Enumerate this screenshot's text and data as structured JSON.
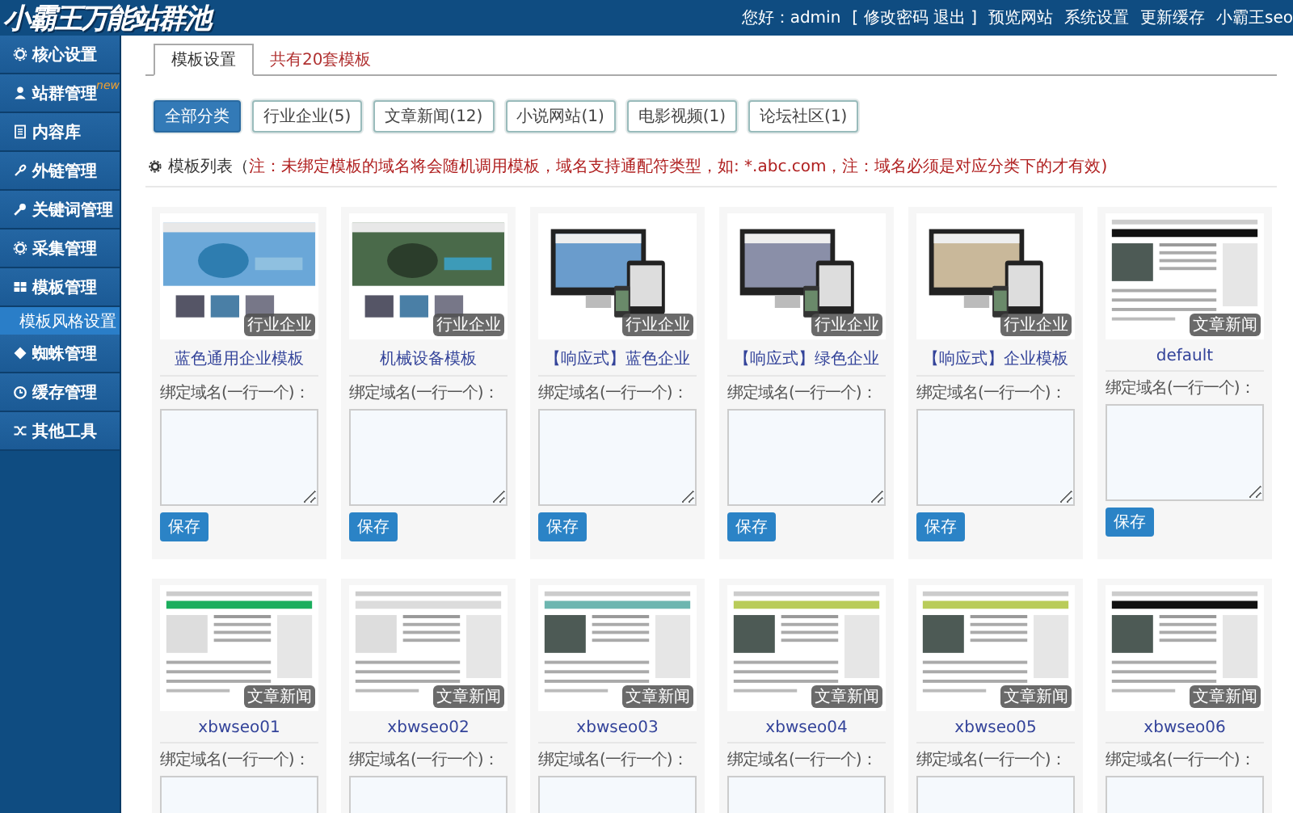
{
  "header": {
    "logo": "小霸王万能站群池",
    "links": [
      "您好：admin",
      "[ 修改密码 退出 ]",
      "预览网站",
      "系统设置",
      "更新缓存",
      "小霸王seo"
    ]
  },
  "sidebar": {
    "items": [
      {
        "label": "核心设置",
        "selected": false
      },
      {
        "label": "站群管理",
        "badge": "new",
        "selected": false
      },
      {
        "label": "内容库",
        "selected": false
      },
      {
        "label": "外链管理",
        "selected": false
      },
      {
        "label": "关键词管理",
        "selected": false
      },
      {
        "label": "采集管理",
        "selected": false
      },
      {
        "label": "模板管理",
        "selected": false,
        "children": [
          {
            "label": "模板风格设置",
            "selected": true
          }
        ]
      },
      {
        "label": "蜘蛛管理",
        "selected": false
      },
      {
        "label": "缓存管理",
        "selected": false
      },
      {
        "label": "其他工具",
        "selected": false
      }
    ]
  },
  "tabs": [
    {
      "label": "模板设置",
      "selected": true
    },
    {
      "label": "共有20套模板",
      "selected": false
    }
  ],
  "filters": [
    {
      "label": "全部分类",
      "selected": true
    },
    {
      "label": "行业企业(5)",
      "selected": false
    },
    {
      "label": "文章新闻(12)",
      "selected": false
    },
    {
      "label": "小说网站(1)",
      "selected": false
    },
    {
      "label": "电影视频(1)",
      "selected": false
    },
    {
      "label": "论坛社区(1)",
      "selected": false
    }
  ],
  "notice": {
    "label": "模板列表（",
    "note": "注：未绑定模板的域名将会随机调用模板，域名支持通配符类型，如: *.abc.com，注：域名必须是对应分类下的才有效)"
  },
  "templates": [
    {
      "name": "蓝色通用企业模板",
      "tag": "行业企业",
      "kind": "picture",
      "field_label": "绑定域名(一行一个)：",
      "button": "保存"
    },
    {
      "name": "机械设备模板",
      "tag": "行业企业",
      "kind": "picture",
      "field_label": "绑定域名(一行一个)：",
      "button": "保存"
    },
    {
      "name": "【响应式】蓝色企业",
      "tag": "行业企业",
      "kind": "picture",
      "field_label": "绑定域名(一行一个)：",
      "button": "保存"
    },
    {
      "name": "【响应式】绿色企业",
      "tag": "行业企业",
      "kind": "picture",
      "field_label": "绑定域名(一行一个)：",
      "button": "保存"
    },
    {
      "name": "【响应式】企业模板",
      "tag": "行业企业",
      "kind": "picture",
      "field_label": "绑定域名(一行一个)：",
      "button": "保存"
    },
    {
      "name": "default",
      "tag": "文章新闻",
      "kind": "picture",
      "field_label": "绑定域名(一行一个)：",
      "button": "保存"
    },
    {
      "name": "xbwseo01",
      "tag": "文章新闻",
      "kind": "picture",
      "field_label": "绑定域名(一行一个)："
    },
    {
      "name": "xbwseo02",
      "tag": "文章新闻",
      "kind": "picture",
      "field_label": "绑定域名(一行一个)："
    },
    {
      "name": "xbwseo03",
      "tag": "文章新闻",
      "kind": "picture",
      "field_label": "绑定域名(一行一个)："
    },
    {
      "name": "xbwseo04",
      "tag": "文章新闻",
      "kind": "picture",
      "field_label": "绑定域名(一行一个)："
    },
    {
      "name": "xbwseo05",
      "tag": "文章新闻",
      "kind": "picture",
      "field_label": "绑定域名(一行一个)："
    },
    {
      "name": "xbwseo06",
      "tag": "文章新闻",
      "kind": "picture",
      "field_label": "绑定域名(一行一个)："
    }
  ]
}
